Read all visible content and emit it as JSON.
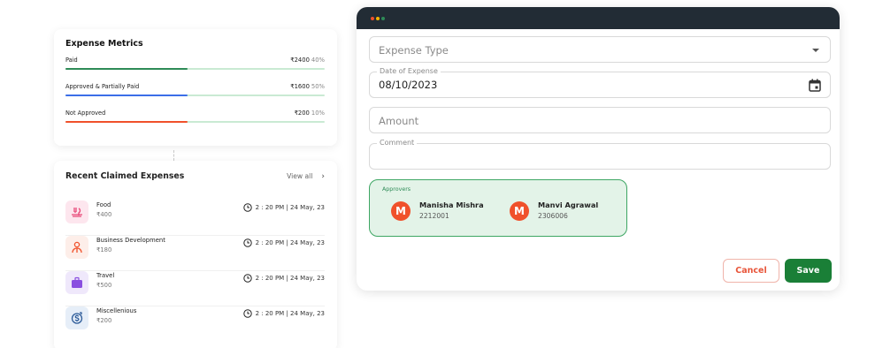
{
  "metrics": {
    "title": "Expense Metrics",
    "items": [
      {
        "label": "Paid",
        "amount": "₹2400",
        "percent": "40%",
        "fill": 0.47,
        "color": "#2e8b57",
        "track": "#c9ead3"
      },
      {
        "label": "Approved & Partially Paid",
        "amount": "₹1600",
        "percent": "50%",
        "fill": 0.47,
        "color": "#3b6ee8",
        "track": "#c9ead3"
      },
      {
        "label": "Not Approved",
        "amount": "₹200",
        "percent": "10%",
        "fill": 0.47,
        "color": "#f0512b",
        "track": "#c9ead3"
      }
    ]
  },
  "recent": {
    "title": "Recent Claimed Expenses",
    "view_all": "View all",
    "items": [
      {
        "name": "Food",
        "amount": "₹400",
        "time": "2 : 20 PM | 24 May, 23",
        "icon": "food-icon",
        "icon_bg": "#fde6ee",
        "icon_color": "#e84a78"
      },
      {
        "name": "Business Development",
        "amount": "₹180",
        "time": "2 : 20 PM | 24 May, 23",
        "icon": "person-icon",
        "icon_bg": "#fdeee9",
        "icon_color": "#f0512b"
      },
      {
        "name": "Travel",
        "amount": "₹500",
        "time": "2 : 20 PM | 24 May, 23",
        "icon": "suitcase-icon",
        "icon_bg": "#efe8fb",
        "icon_color": "#8a4fe0"
      },
      {
        "name": "Miscellenious",
        "amount": "₹200",
        "time": "2 : 20 PM | 24 May, 23",
        "icon": "money-icon",
        "icon_bg": "#e6eef8",
        "icon_color": "#2f5d9a"
      }
    ]
  },
  "form": {
    "window_dots": [
      "#f0512b",
      "#f5b400",
      "#2e8b57"
    ],
    "expense_type": {
      "placeholder": "Expense Type"
    },
    "date": {
      "label": "Date of Expense",
      "value": "08/10/2023"
    },
    "amount": {
      "placeholder": "Amount"
    },
    "comment": {
      "label": "Comment"
    },
    "approvers": {
      "label": "Approvers",
      "people": [
        {
          "initial": "M",
          "name": "Manisha Mishra",
          "id": "2212001"
        },
        {
          "initial": "M",
          "name": "Manvi Agrawal",
          "id": "2306006"
        }
      ]
    },
    "cancel_label": "Cancel",
    "save_label": "Save"
  }
}
